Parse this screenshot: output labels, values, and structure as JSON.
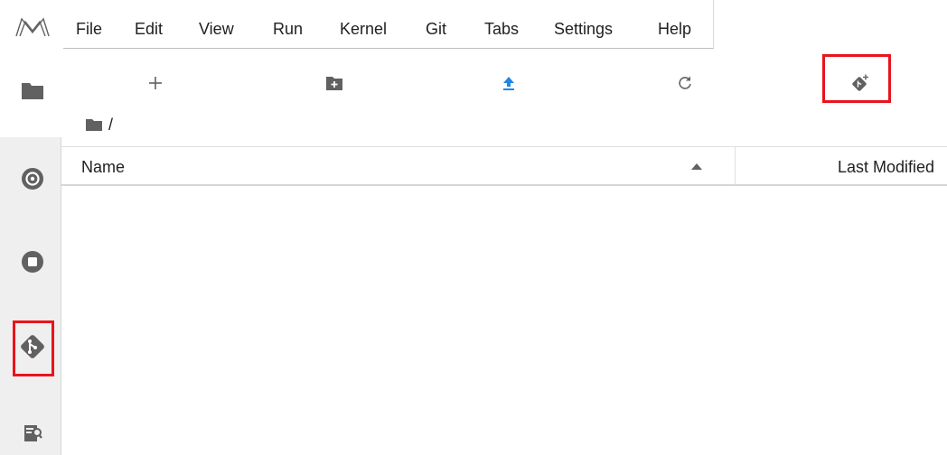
{
  "menubar": {
    "logo": "jupyter-logo-icon",
    "items": [
      "File",
      "Edit",
      "View",
      "Run",
      "Kernel",
      "Git",
      "Tabs",
      "Settings",
      "Help"
    ]
  },
  "sidebar": {
    "icons": [
      "folder-icon",
      "running-icon",
      "stop-circle-icon",
      "git-icon",
      "property-inspector-icon"
    ]
  },
  "toolbar": {
    "icons": [
      "plus-icon",
      "new-folder-icon",
      "upload-icon",
      "refresh-icon",
      "git-clone-icon"
    ]
  },
  "breadcrumb": {
    "path": "/"
  },
  "filelist": {
    "columns": {
      "name": "Name",
      "modified": "Last Modified"
    },
    "rows": []
  },
  "colors": {
    "icon": "#616161",
    "accent": "#1e88e5",
    "highlight": "#e8141c",
    "sidebar_bg": "#efefef"
  }
}
